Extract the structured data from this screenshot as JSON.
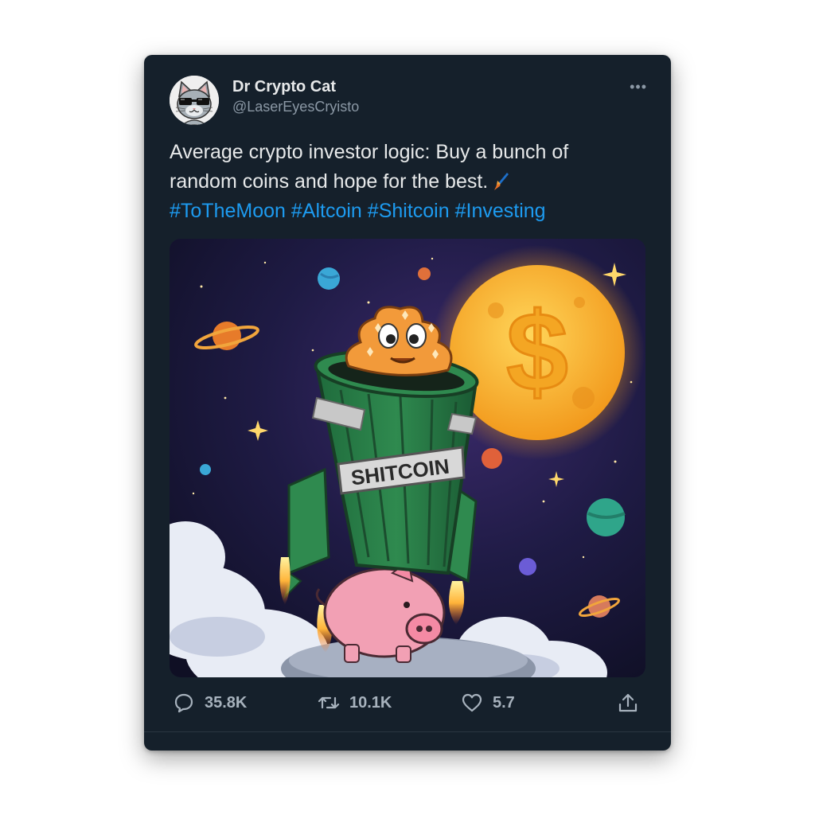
{
  "tweet": {
    "author": {
      "display_name": "Dr Crypto Cat",
      "handle": "@LaserEyesCryisto",
      "avatar_icon": "cat-with-sunglasses-avatar"
    },
    "text_line1": "Average crypto investor logic: Buy a bunch of",
    "text_line2": "random coins and hope for the best.",
    "emoji_icon": "rocket-icon",
    "hashtags": [
      "#ToTheMoon",
      "#Altcoin",
      "#Shitcoin",
      "#Investing"
    ],
    "more_icon": "more-options-icon",
    "media": {
      "label_on_can": "SHITCOIN",
      "moon_symbol": "$"
    },
    "actions": {
      "replies": "35.8K",
      "retweets": "10.1K",
      "likes": "5.7"
    }
  },
  "colors": {
    "card_bg": "#15202b",
    "text": "#e7e9ea",
    "muted": "#8b98a5",
    "link": "#1d9bf0",
    "action_counts": "#a7b2bd"
  }
}
